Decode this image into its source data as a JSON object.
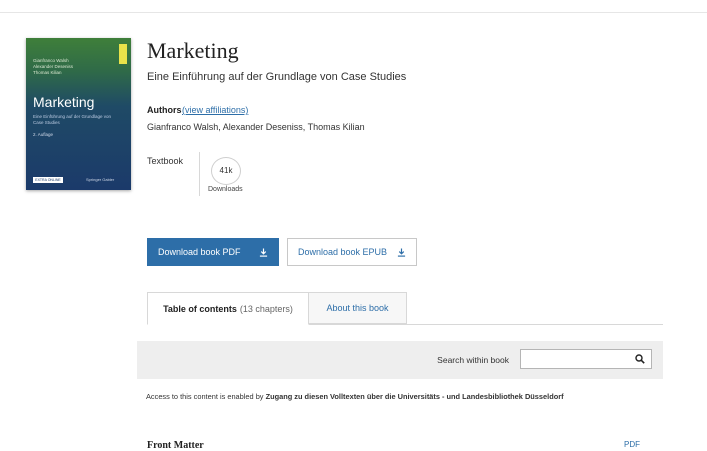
{
  "book": {
    "title": "Marketing",
    "subtitle": "Eine Einführung auf der Grundlage von Case Studies",
    "authors_label": "Authors",
    "affiliations_link": "(view affiliations)",
    "authors": "Gianfranco Walsh, Alexander Deseniss, Thomas Kilian",
    "type": "Textbook",
    "downloads_count": "41k",
    "downloads_label": "Downloads"
  },
  "cover": {
    "authors_lines": [
      "Gianfranco Walsh",
      "Alexander Deseniss",
      "Thomas Kilian"
    ],
    "title": "Marketing",
    "subtitle": "Eine Einführung auf der Grundlage von Case Studies",
    "edition": "2. Auflage",
    "badge": "EXTRA ONLINE",
    "publisher": "Springer Gabler"
  },
  "actions": {
    "download_pdf": "Download book PDF",
    "download_epub": "Download book EPUB"
  },
  "tabs": {
    "toc_label": "Table of contents",
    "toc_count": "(13 chapters)",
    "about_label": "About this book"
  },
  "search": {
    "label": "Search within book",
    "value": ""
  },
  "access": {
    "prefix": "Access to this content is enabled by",
    "library": "Zugang zu diesen Volltexten über die Universitäts - und Landesbibliothek Düsseldorf"
  },
  "contents": {
    "front_matter": "Front Matter",
    "front_matter_pdf": "PDF"
  },
  "colors": {
    "accent": "#2d6ea8",
    "band": "#eeeeee"
  },
  "icons": {
    "download": "download-icon",
    "search": "search-icon"
  }
}
